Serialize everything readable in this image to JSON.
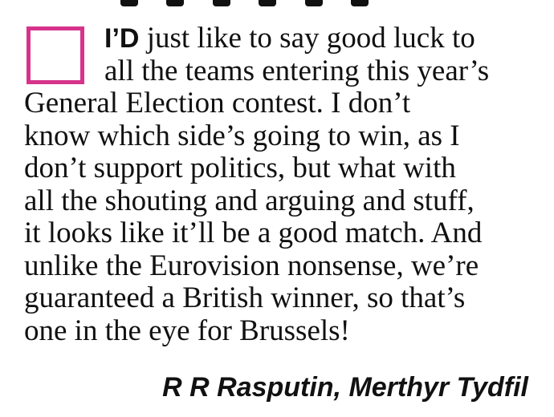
{
  "letter": {
    "lead_word": "I’D",
    "lines": [
      " just like to say good luck to",
      "all the teams entering this year’s",
      "General Election contest. I don’t",
      "know which side’s going to win, as I",
      "don’t support politics, but what with",
      "all the shouting and arguing and stuff,",
      "it looks like it’ll be a good match. And",
      "unlike the Eurovision nonsense, we’re",
      "guaranteed a British winner, so that’s",
      "one in the eye for Brussels!"
    ],
    "signature": "R R Rasputin, Merthyr Tydfil"
  },
  "colors": {
    "bullet_border": "#d6338c",
    "text": "#111111"
  }
}
